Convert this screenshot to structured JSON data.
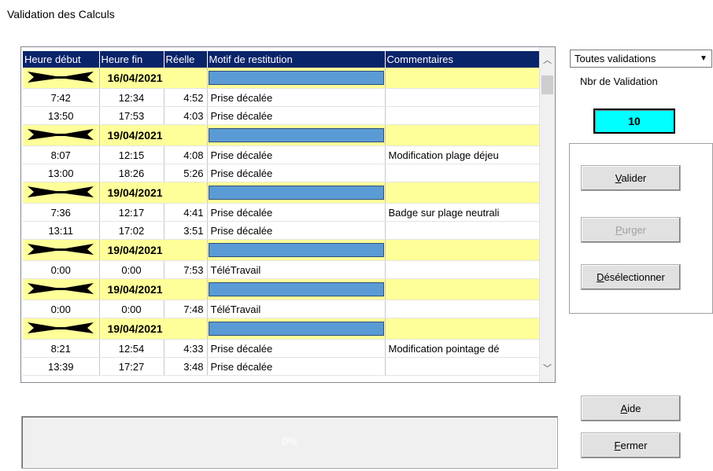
{
  "window": {
    "title": "Validation des Calculs"
  },
  "grid": {
    "columns": [
      "Heure début",
      "Heure fin",
      "Réelle",
      "Motif de restitution",
      "Commentaires"
    ],
    "rows": [
      {
        "type": "date",
        "date": "16/04/2021"
      },
      {
        "type": "data",
        "debut": "7:42",
        "fin": "12:34",
        "reelle": "4:52",
        "motif": "Prise décalée",
        "commentaire": ""
      },
      {
        "type": "data",
        "debut": "13:50",
        "fin": "17:53",
        "reelle": "4:03",
        "motif": "Prise décalée",
        "commentaire": ""
      },
      {
        "type": "date",
        "date": "19/04/2021"
      },
      {
        "type": "data",
        "debut": "8:07",
        "fin": "12:15",
        "reelle": "4:08",
        "motif": "Prise décalée",
        "commentaire": "Modification plage déjeu"
      },
      {
        "type": "data",
        "debut": "13:00",
        "fin": "18:26",
        "reelle": "5:26",
        "motif": "Prise décalée",
        "commentaire": ""
      },
      {
        "type": "date",
        "date": "19/04/2021"
      },
      {
        "type": "data",
        "debut": "7:36",
        "fin": "12:17",
        "reelle": "4:41",
        "motif": "Prise décalée",
        "commentaire": "Badge sur plage neutrali"
      },
      {
        "type": "data",
        "debut": "13:11",
        "fin": "17:02",
        "reelle": "3:51",
        "motif": "Prise décalée",
        "commentaire": ""
      },
      {
        "type": "date",
        "date": "19/04/2021"
      },
      {
        "type": "data",
        "debut": "0:00",
        "fin": "0:00",
        "reelle": "7:53",
        "motif": "TéléTravail",
        "commentaire": ""
      },
      {
        "type": "date",
        "date": "19/04/2021"
      },
      {
        "type": "data",
        "debut": "0:00",
        "fin": "0:00",
        "reelle": "7:48",
        "motif": "TéléTravail",
        "commentaire": ""
      },
      {
        "type": "date",
        "date": "19/04/2021"
      },
      {
        "type": "data",
        "debut": "8:21",
        "fin": "12:54",
        "reelle": "4:33",
        "motif": "Prise décalée",
        "commentaire": "Modification pointage dé"
      },
      {
        "type": "data",
        "debut": "13:39",
        "fin": "17:27",
        "reelle": "3:48",
        "motif": "Prise décalée",
        "commentaire": ""
      }
    ]
  },
  "filter": {
    "selected": "Toutes validations"
  },
  "nbr_label": "Nbr de Validation",
  "nbr_value": "10",
  "buttons": {
    "valider": {
      "key": "V",
      "rest": "alider"
    },
    "purger": {
      "key": "P",
      "rest": "urger"
    },
    "deselectionner": {
      "key": "D",
      "rest": "ésélectionner"
    },
    "aide": {
      "key": "A",
      "rest": "ide"
    },
    "fermer": {
      "key": "F",
      "rest": "ermer"
    }
  },
  "progress": {
    "value": "0%"
  },
  "icons": {
    "row_marker": "crossed-arrows-icon",
    "scroll_up": "chevron-up-icon",
    "scroll_down": "chevron-down-icon",
    "combo_drop": "triangle-down-icon"
  },
  "colors": {
    "header_bg": "#0a246a",
    "date_row_bg": "#ffff99",
    "blue_cell": "#5b9bd5",
    "count_bg": "#00ffff"
  }
}
